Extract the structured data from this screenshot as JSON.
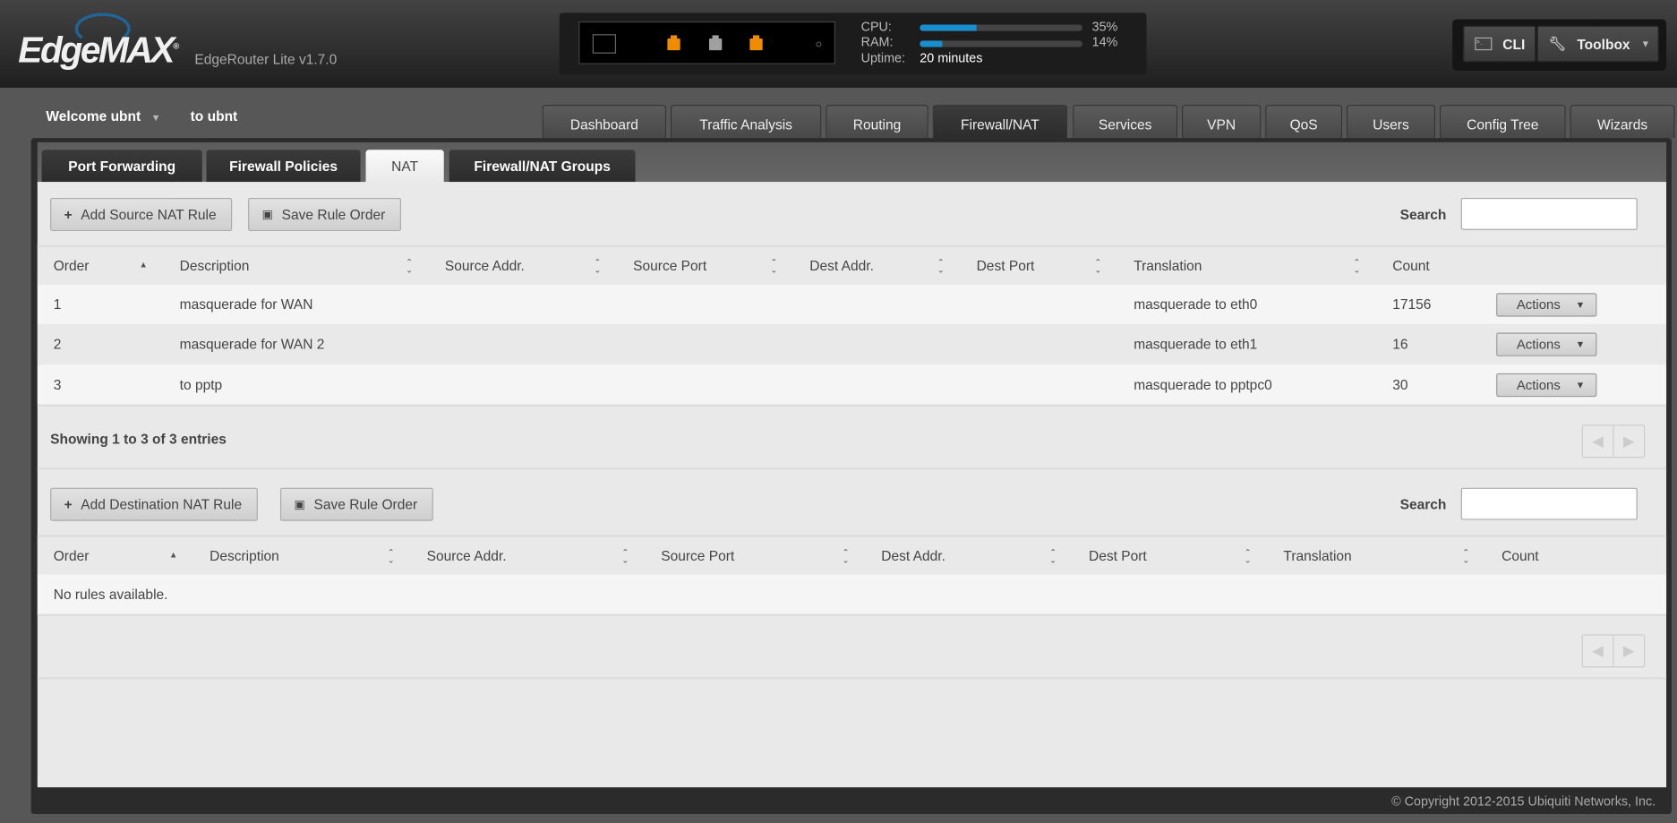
{
  "header": {
    "logo": "EdgeMAX",
    "version": "EdgeRouter Lite v1.7.0",
    "cpu_label": "CPU:",
    "ram_label": "RAM:",
    "uptime_label": "Uptime:",
    "cpu_pct": "35%",
    "ram_pct": "14%",
    "cpu_value": 35,
    "ram_value": 14,
    "uptime": "20 minutes",
    "cli": "CLI",
    "toolbox": "Toolbox"
  },
  "ports": [
    {
      "color": "#f08c00"
    },
    {
      "color": "#a0a0a0"
    },
    {
      "color": "#f08c00"
    }
  ],
  "user": {
    "welcome": "Welcome ubnt",
    "to": "to ubnt"
  },
  "nav": [
    "Dashboard",
    "Traffic Analysis",
    "Routing",
    "Firewall/NAT",
    "Services",
    "VPN",
    "QoS",
    "Users",
    "Config Tree",
    "Wizards"
  ],
  "subtabs": [
    "Port Forwarding",
    "Firewall Policies",
    "NAT",
    "Firewall/NAT Groups"
  ],
  "source": {
    "add": "Add Source NAT Rule",
    "save": "Save Rule Order",
    "search": "Search",
    "columns": [
      "Order",
      "Description",
      "Source Addr.",
      "Source Port",
      "Dest Addr.",
      "Dest Port",
      "Translation",
      "Count"
    ],
    "rows": [
      {
        "order": "1",
        "desc": "masquerade for WAN",
        "translation": "masquerade to eth0",
        "count": "17156",
        "actions": "Actions"
      },
      {
        "order": "2",
        "desc": "masquerade for WAN 2",
        "translation": "masquerade to eth1",
        "count": "16",
        "actions": "Actions"
      },
      {
        "order": "3",
        "desc": "to pptp",
        "translation": "masquerade to pptpc0",
        "count": "30",
        "actions": "Actions"
      }
    ],
    "showing": "Showing 1 to 3 of 3 entries"
  },
  "dest": {
    "add": "Add Destination NAT Rule",
    "save": "Save Rule Order",
    "search": "Search",
    "columns": [
      "Order",
      "Description",
      "Source Addr.",
      "Source Port",
      "Dest Addr.",
      "Dest Port",
      "Translation",
      "Count"
    ],
    "empty": "No rules available."
  },
  "footer": {
    "copyright": "© Copyright 2012-2015 Ubiquiti Networks, Inc."
  }
}
